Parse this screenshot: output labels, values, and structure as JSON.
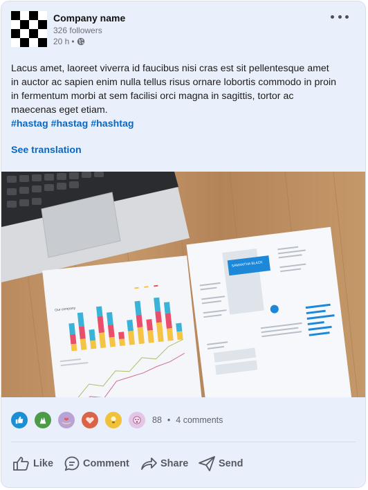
{
  "post": {
    "company_name": "Company name",
    "followers": "326 followers",
    "time": "20 h",
    "separator": "•",
    "body": "Lacus amet, laoreet viverra id faucibus nisi cras est sit pellentesque amet in auctor ac sapien enim nulla tellus risus ornare lobortis commodo in proin in fermentum morbi at sem facilisi orci magna in sagittis, tortor ac maecenas eget etiam.",
    "hashtags": [
      "#hastag",
      "#hastag",
      "#hashtag"
    ],
    "see_translation": "See translation"
  },
  "image": {
    "resume_name": "SAMANTHA BLACK",
    "chart_heading": "Our company"
  },
  "reactions": {
    "icons": [
      "like-icon",
      "celebrate-icon",
      "support-icon",
      "love-icon",
      "insightful-icon",
      "curious-icon"
    ],
    "count": "88",
    "dot": "•",
    "comments": "4 comments"
  },
  "actions": {
    "like": "Like",
    "comment": "Comment",
    "share": "Share",
    "send": "Send"
  },
  "colors": {
    "link": "#0a66c2",
    "card_bg": "#eaf0fb"
  }
}
